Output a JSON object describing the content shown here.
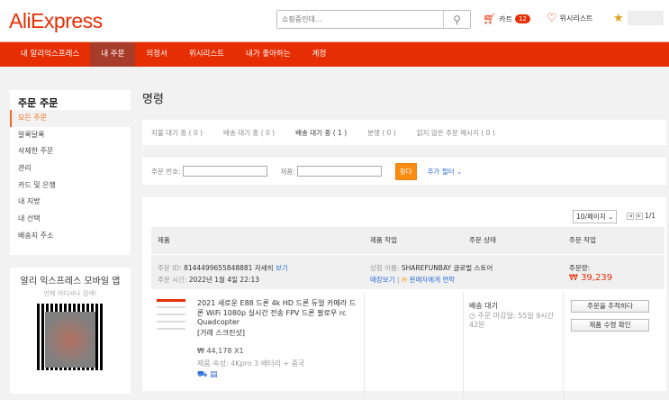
{
  "header": {
    "logo": "AliExpress",
    "search_placeholder": "쇼핑중인데...",
    "cart_label": "카트",
    "cart_count": "12",
    "wishlist_label": "위시리스트"
  },
  "nav": {
    "items": [
      "내 알리익스프레스",
      "내 주문",
      "의정서",
      "위시리스트",
      "내가 좋아하는",
      "계정"
    ],
    "active": 1
  },
  "sidebar": {
    "title": "주문 주문",
    "items": [
      "모든 주문",
      "알록달록",
      "삭제한 주문",
      "관리",
      "카드 및 은행",
      "내 지방",
      "내 선택",
      "배송지 주소"
    ]
  },
  "mobile": {
    "title": "알리 익스프레스 모바일 앱",
    "subtitle": "언제 어디서나 검색!"
  },
  "page": {
    "title": "명령"
  },
  "tabs": [
    "지불 대기 중 ( 0 )",
    "배송 대기 중 ( 0 )",
    "배송 대기 중 ( 1 )",
    "분쟁 ( 0 )",
    "읽지 않은 주문 메시지 ( 0 )"
  ],
  "filter": {
    "order_no_label": "주문 번호:",
    "product_label": "제품:",
    "find": "찾다",
    "more": "추가 필터"
  },
  "orders": {
    "per_page": "10/페이지",
    "page": "1/1",
    "columns": [
      "제품",
      "제품 작업",
      "주문 상태",
      "주문 작업"
    ],
    "order_id_label": "주문 ID:",
    "order_id": "8144499655848881",
    "detail_a": "자세히",
    "detail_b": "보기",
    "time_label": "주문 시간:",
    "time": "2022년 1월 4일 22:13",
    "store_label": "상점 이름:",
    "store": "SHAREFUNBAY 글로벌 스토어",
    "view_store": "매장보기",
    "contact": "판매자에게 연락",
    "amount_label": "주문량:",
    "amount": "₩ 39,239",
    "product": {
      "title": "2021 새로운 E88 드론 4k HD 드론 듀얼 카메라 드론 WiFi 1080p 실시간 전송 FPV 드론 팔로우 rc Quadcopter",
      "snapshot": "[거래 스크린샷]",
      "price": "₩ 44,178 X1",
      "attr": "제품 속성: 4Kpro 3 배터리 + 중국"
    },
    "status": "배송 대기",
    "deadline": "주문 마감일: 55일 9시간 42분",
    "track": "주문을 추적하다",
    "confirm": "제품 수령 확인"
  }
}
